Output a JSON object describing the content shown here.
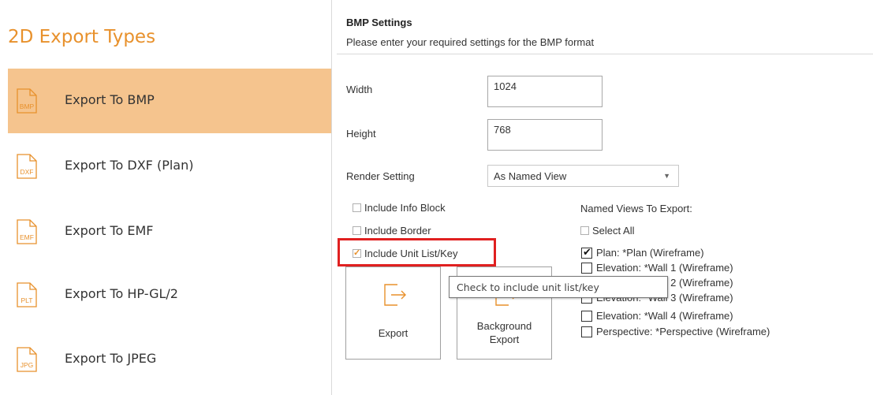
{
  "left": {
    "title": "2D Export Types",
    "items": [
      {
        "icon_text": "BMP",
        "label": "Export To BMP",
        "active": true
      },
      {
        "icon_text": "DXF",
        "label": "Export To DXF (Plan)",
        "active": false
      },
      {
        "icon_text": "EMF",
        "label": "Export To EMF",
        "active": false
      },
      {
        "icon_text": "PLT",
        "label": "Export To HP-GL/2",
        "active": false
      },
      {
        "icon_text": "JPG",
        "label": "Export To JPEG",
        "active": false
      }
    ]
  },
  "settings": {
    "title": "BMP Settings",
    "subtitle": "Please enter your required settings for the BMP format",
    "width_label": "Width",
    "width_value": "1024",
    "height_label": "Height",
    "height_value": "768",
    "render_label": "Render Setting",
    "render_value": "As Named View",
    "options": {
      "include_info_block": {
        "label": "Include Info Block",
        "checked": false
      },
      "include_border": {
        "label": "Include Border",
        "checked": false
      },
      "include_unit_list": {
        "label": "Include Unit List/Key",
        "checked": true
      }
    },
    "named_views_label": "Named Views To Export:",
    "select_all_label": "Select All",
    "named_views": [
      {
        "label": "Plan: *Plan (Wireframe)",
        "checked": true
      },
      {
        "label": "Elevation: *Wall 1 (Wireframe)",
        "checked": false
      },
      {
        "label": "Elevation: *Wall 2 (Wireframe)",
        "checked": false
      },
      {
        "label": "Elevation: *Wall 3 (Wireframe)",
        "checked": false
      },
      {
        "label": "Elevation: *Wall 4 (Wireframe)",
        "checked": false
      },
      {
        "label": "Perspective: *Perspective (Wireframe)",
        "checked": false
      }
    ],
    "export_button": "Export",
    "background_export_button_line1": "Background",
    "background_export_button_line2": "Export",
    "tooltip": "Check to include unit list/key"
  },
  "colors": {
    "accent": "#e8912c",
    "active_item_bg": "#f5c48e",
    "highlight": "#e02020"
  }
}
